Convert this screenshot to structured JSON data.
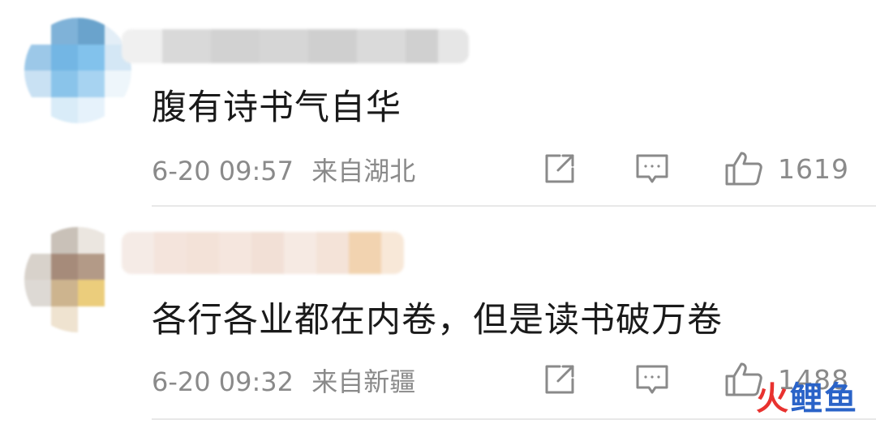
{
  "comments": [
    {
      "text": "腹有诗书气自华",
      "time": "6-20 09:57",
      "location": "来自湖北",
      "likes": "1619",
      "share_icon": "share-icon",
      "reply_icon": "comment-icon",
      "like_icon": "thumbs-up-icon"
    },
    {
      "text": "各行各业都在内卷，但是读书破万卷",
      "time": "6-20 09:32",
      "location": "来自新疆",
      "likes": "1488",
      "share_icon": "share-icon",
      "reply_icon": "comment-icon",
      "like_icon": "thumbs-up-icon"
    }
  ],
  "watermark": {
    "part1": "火",
    "part2": "鲤鱼"
  },
  "colors": {
    "text": "#1a1a1a",
    "meta": "#8a8a8a",
    "divider": "#e8e8e8",
    "watermark_red": "#e8322f",
    "watermark_blue": "#2a63c8"
  }
}
